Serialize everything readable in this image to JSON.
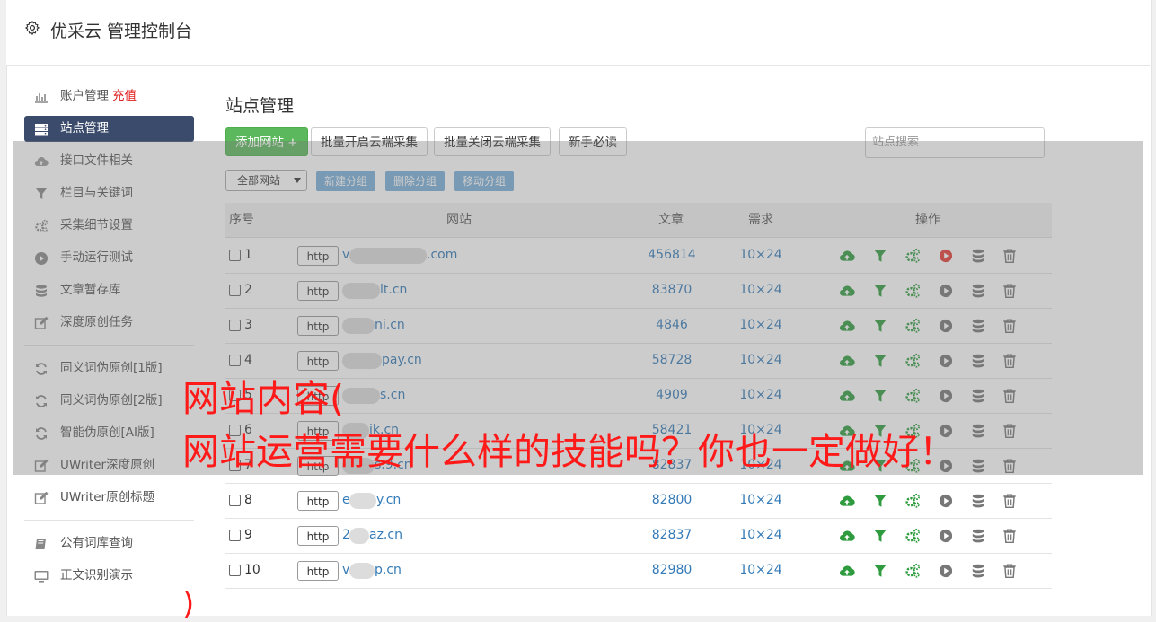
{
  "header": {
    "title": "优采云 管理控制台"
  },
  "sidebar": {
    "items": [
      {
        "label": "账户管理",
        "badge": "充值",
        "icon": "bar-chart-icon"
      },
      {
        "label": "站点管理",
        "icon": "server-icon",
        "active": true
      },
      {
        "label": "接口文件相关",
        "icon": "cloud-upload-icon"
      },
      {
        "label": "栏目与关键词",
        "icon": "filter-icon"
      },
      {
        "label": "采集细节设置",
        "icon": "cogs-icon"
      },
      {
        "label": "手动运行测试",
        "icon": "play-circle-icon"
      },
      {
        "label": "文章暂存库",
        "icon": "database-icon"
      },
      {
        "label": "深度原创任务",
        "icon": "edit-icon"
      }
    ],
    "items2": [
      {
        "label": "同义词伪原创[1版]",
        "icon": "refresh-icon"
      },
      {
        "label": "同义词伪原创[2版]",
        "icon": "refresh-icon"
      },
      {
        "label": "智能伪原创[AI版]",
        "icon": "refresh-icon"
      },
      {
        "label": "UWriter深度原创",
        "icon": "edit-icon"
      },
      {
        "label": "UWriter原创标题",
        "icon": "edit-icon"
      }
    ],
    "items3": [
      {
        "label": "公有词库查询",
        "icon": "book-icon"
      },
      {
        "label": "正文识别演示",
        "icon": "monitor-icon"
      }
    ]
  },
  "main": {
    "title": "站点管理",
    "buttons": {
      "add": "添加网站 +",
      "batch_on": "批量开启云端采集",
      "batch_off": "批量关闭云端采集",
      "guide": "新手必读"
    },
    "search_placeholder": "站点搜索",
    "group_select": "全部网站",
    "group_buttons": {
      "new": "新建分组",
      "delete": "删除分组",
      "move": "移动分组"
    },
    "table": {
      "headers": {
        "index": "序号",
        "site": "网站",
        "articles": "文章",
        "demand": "需求",
        "ops": "操作"
      },
      "rows": [
        {
          "index": "1",
          "protocol": "http",
          "domain_prefix": "v",
          "domain_suffix": ".com",
          "articles": "456814",
          "demand": "10×24",
          "running": true
        },
        {
          "index": "2",
          "protocol": "http",
          "domain_prefix": "",
          "domain_suffix": "lt.cn",
          "articles": "83870",
          "demand": "10×24",
          "running": false
        },
        {
          "index": "3",
          "protocol": "http",
          "domain_prefix": "",
          "domain_suffix": "ni.cn",
          "articles": "4846",
          "demand": "10×24",
          "running": false
        },
        {
          "index": "4",
          "protocol": "http",
          "domain_prefix": "",
          "domain_suffix": "pay.cn",
          "articles": "58728",
          "demand": "10×24",
          "running": false
        },
        {
          "index": "5",
          "protocol": "http",
          "domain_prefix": "",
          "domain_suffix": "s.cn",
          "articles": "4909",
          "demand": "10×24",
          "running": false
        },
        {
          "index": "6",
          "protocol": "http",
          "domain_prefix": "",
          "domain_suffix": "ik.cn",
          "articles": "58421",
          "demand": "10×24",
          "running": false
        },
        {
          "index": "7",
          "protocol": "http",
          "domain_prefix": "",
          "domain_suffix": "s.9.cn",
          "articles": "82837",
          "demand": "10×24",
          "running": false
        },
        {
          "index": "8",
          "protocol": "http",
          "domain_prefix": "e",
          "domain_suffix": "y.cn",
          "articles": "82800",
          "demand": "10×24",
          "running": false
        },
        {
          "index": "9",
          "protocol": "http",
          "domain_prefix": "2",
          "domain_suffix": "az.cn",
          "articles": "82837",
          "demand": "10×24",
          "running": false
        },
        {
          "index": "10",
          "protocol": "http",
          "domain_prefix": "v",
          "domain_suffix": "p.cn",
          "articles": "82980",
          "demand": "10×24",
          "running": false
        }
      ]
    }
  },
  "overlay": {
    "line1": "网站内容(",
    "line2": "网站运营需要什么样的技能吗？你也一定做好！",
    "line3": ")"
  },
  "colors": {
    "accent_green": "#5cb85c",
    "sidebar_active": "#3b4b6b",
    "link_blue": "#337ab7",
    "overlay_red": "#ff1a1a",
    "run_red": "#e53935",
    "ops_green": "#2e9c3e"
  }
}
